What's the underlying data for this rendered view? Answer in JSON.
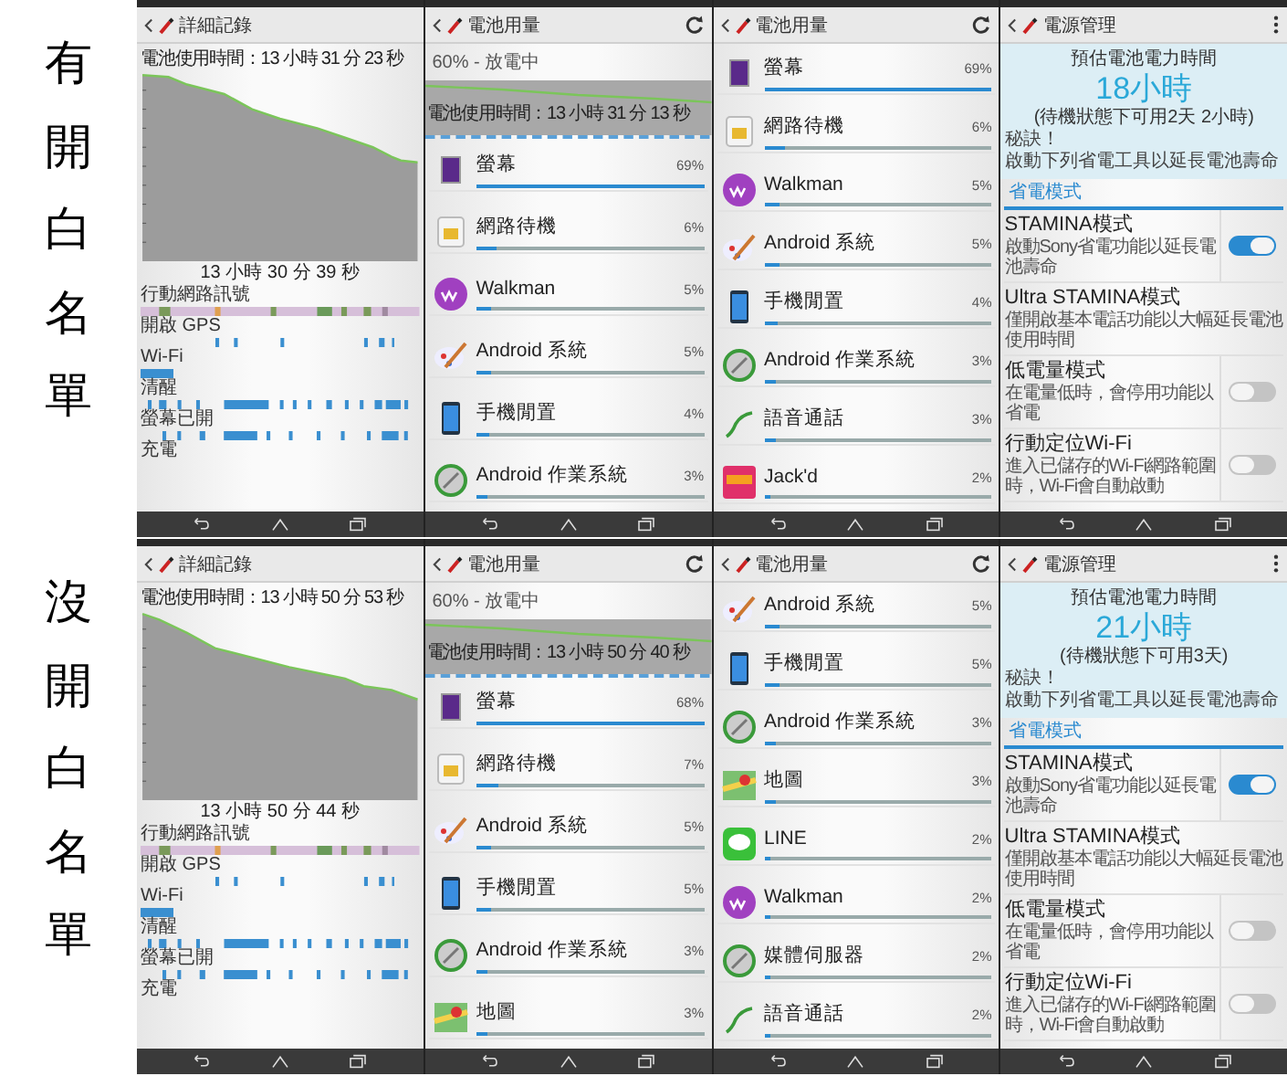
{
  "rows": [
    {
      "label": "有開白名單",
      "panels": [
        {
          "kind": "history",
          "title": "詳細記錄",
          "usage_time": "電池使用時間：13 小時 31 分 23 秒",
          "end_time": "13 小時 30 分 39 秒",
          "signals": [
            {
              "label": "行動網路訊號",
              "kind": "cellular"
            },
            {
              "label": "開啟 GPS",
              "kind": "gps"
            },
            {
              "label": "Wi-Fi",
              "kind": "wifi"
            },
            {
              "label": "清醒",
              "kind": "awake"
            },
            {
              "label": "螢幕已開",
              "kind": "screen"
            },
            {
              "label": "充電",
              "kind": "charging"
            }
          ]
        },
        {
          "kind": "usage",
          "title": "電池用量",
          "status": "60% - 放電中",
          "graph_caption": "電池使用時間：13 小時 31 分 13 秒",
          "items": [
            {
              "name": "螢幕",
              "percent": "69%",
              "level": 1.0,
              "kind": "screen"
            },
            {
              "name": "網路待機",
              "percent": "6%",
              "level": 0.09,
              "kind": "sim"
            },
            {
              "name": "Walkman",
              "percent": "5%",
              "level": 0.07,
              "kind": "walkman"
            },
            {
              "name": "Android 系統",
              "percent": "5%",
              "level": 0.07,
              "kind": "palette"
            },
            {
              "name": "手機閒置",
              "percent": "4%",
              "level": 0.06,
              "kind": "phone"
            },
            {
              "name": "Android 作業系統",
              "percent": "3%",
              "level": 0.05,
              "kind": "android"
            }
          ]
        },
        {
          "kind": "usage",
          "title": "電池用量",
          "items": [
            {
              "name": "螢幕",
              "percent": "69%",
              "level": 1.0,
              "kind": "screen"
            },
            {
              "name": "網路待機",
              "percent": "6%",
              "level": 0.09,
              "kind": "sim"
            },
            {
              "name": "Walkman",
              "percent": "5%",
              "level": 0.07,
              "kind": "walkman"
            },
            {
              "name": "Android 系統",
              "percent": "5%",
              "level": 0.07,
              "kind": "palette"
            },
            {
              "name": "手機閒置",
              "percent": "4%",
              "level": 0.06,
              "kind": "phone"
            },
            {
              "name": "Android 作業系統",
              "percent": "3%",
              "level": 0.05,
              "kind": "android"
            },
            {
              "name": "語音通話",
              "percent": "3%",
              "level": 0.05,
              "kind": "voice"
            },
            {
              "name": "Jack'd",
              "percent": "2%",
              "level": 0.03,
              "kind": "jackd"
            }
          ]
        },
        {
          "kind": "power",
          "title": "電源管理",
          "estimate_label": "預估電池電力時間",
          "estimate": "18小時",
          "standby": "(待機狀態下可用2天 2小時)",
          "tip_title": "秘訣！",
          "tip": "啟動下列省電工具以延長電池壽命",
          "section": "省電模式",
          "settings": [
            {
              "title": "STAMINA模式",
              "desc": "啟動Sony省電功能以延長電池壽命",
              "kind": "toggle",
              "on": true
            },
            {
              "title": "Ultra STAMINA模式",
              "desc": "僅開啟基本電話功能以大幅延長電池使用時間",
              "kind": "plain"
            },
            {
              "title": "低電量模式",
              "desc": "在電量低時，會停用功能以省電",
              "kind": "toggle",
              "on": false
            },
            {
              "title": "行動定位Wi-Fi",
              "desc": "進入已儲存的Wi-Fi網路範圍時，Wi-Fi會自動啟動",
              "kind": "toggle",
              "on": false
            }
          ]
        }
      ]
    },
    {
      "label": "沒開白名單",
      "panels": [
        {
          "kind": "history",
          "title": "詳細記錄",
          "usage_time": "電池使用時間：13 小時 50 分 53 秒",
          "end_time": "13 小時 50 分 44 秒",
          "signals": [
            {
              "label": "行動網路訊號",
              "kind": "cellular"
            },
            {
              "label": "開啟 GPS",
              "kind": "gps"
            },
            {
              "label": "Wi-Fi",
              "kind": "wifi"
            },
            {
              "label": "清醒",
              "kind": "awake"
            },
            {
              "label": "螢幕已開",
              "kind": "screen"
            },
            {
              "label": "充電",
              "kind": "charging"
            }
          ]
        },
        {
          "kind": "usage",
          "title": "電池用量",
          "status": "60% - 放電中",
          "graph_caption": "電池使用時間：13 小時 50 分 40 秒",
          "items": [
            {
              "name": "螢幕",
              "percent": "68%",
              "level": 1.0,
              "kind": "screen"
            },
            {
              "name": "網路待機",
              "percent": "7%",
              "level": 0.1,
              "kind": "sim"
            },
            {
              "name": "Android 系統",
              "percent": "5%",
              "level": 0.07,
              "kind": "palette"
            },
            {
              "name": "手機閒置",
              "percent": "5%",
              "level": 0.07,
              "kind": "phone"
            },
            {
              "name": "Android 作業系統",
              "percent": "3%",
              "level": 0.05,
              "kind": "android"
            },
            {
              "name": "地圖",
              "percent": "3%",
              "level": 0.05,
              "kind": "maps"
            }
          ]
        },
        {
          "kind": "usage",
          "title": "電池用量",
          "items": [
            {
              "name": "Android 系統",
              "percent": "5%",
              "level": 0.07,
              "kind": "palette"
            },
            {
              "name": "手機閒置",
              "percent": "5%",
              "level": 0.07,
              "kind": "phone"
            },
            {
              "name": "Android 作業系統",
              "percent": "3%",
              "level": 0.05,
              "kind": "android"
            },
            {
              "name": "地圖",
              "percent": "3%",
              "level": 0.05,
              "kind": "maps"
            },
            {
              "name": "LINE",
              "percent": "2%",
              "level": 0.03,
              "kind": "line"
            },
            {
              "name": "Walkman",
              "percent": "2%",
              "level": 0.03,
              "kind": "walkman"
            },
            {
              "name": "媒體伺服器",
              "percent": "2%",
              "level": 0.03,
              "kind": "android"
            },
            {
              "name": "語音通話",
              "percent": "2%",
              "level": 0.03,
              "kind": "voice"
            }
          ]
        },
        {
          "kind": "power",
          "title": "電源管理",
          "estimate_label": "預估電池電力時間",
          "estimate": "21小時",
          "standby": "(待機狀態下可用3天)",
          "tip_title": "秘訣！",
          "tip": "啟動下列省電工具以延長電池壽命",
          "section": "省電模式",
          "settings": [
            {
              "title": "STAMINA模式",
              "desc": "啟動Sony省電功能以延長電池壽命",
              "kind": "toggle",
              "on": true
            },
            {
              "title": "Ultra STAMINA模式",
              "desc": "僅開啟基本電話功能以大幅延長電池使用時間",
              "kind": "plain"
            },
            {
              "title": "低電量模式",
              "desc": "在電量低時，會停用功能以省電",
              "kind": "toggle",
              "on": false
            },
            {
              "title": "行動定位Wi-Fi",
              "desc": "進入已儲存的Wi-Fi網路範圍時，Wi-Fi會自動啟動",
              "kind": "toggle",
              "on": false
            }
          ]
        }
      ]
    }
  ]
}
